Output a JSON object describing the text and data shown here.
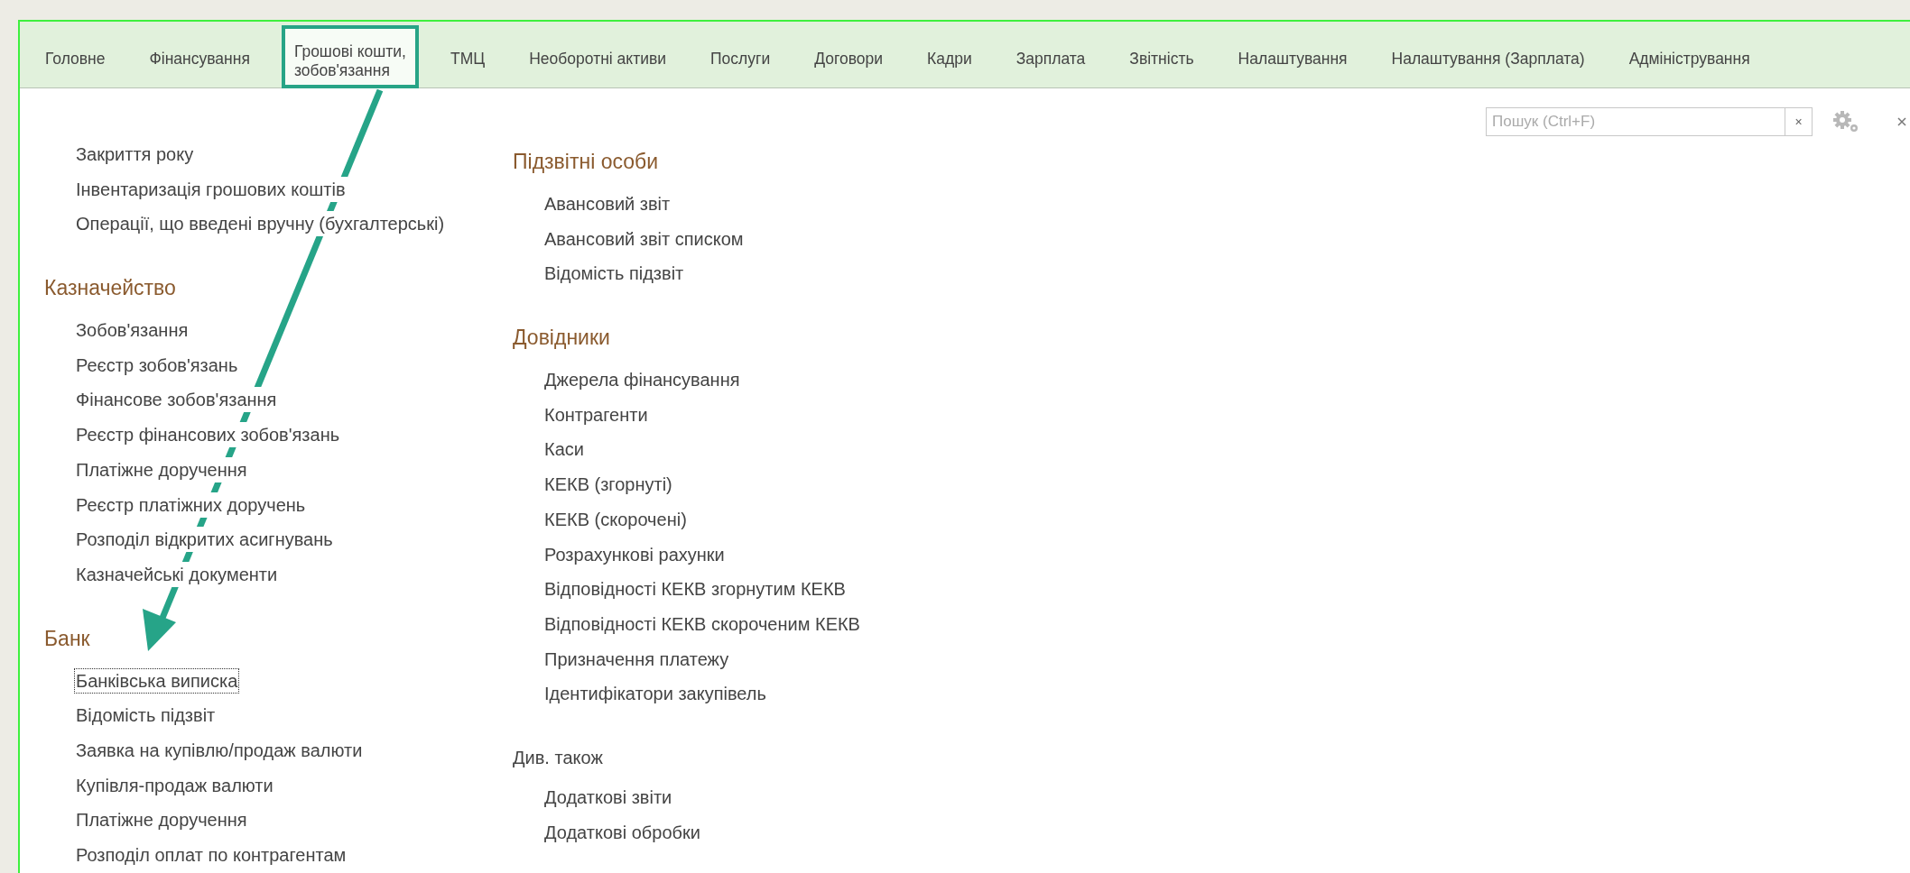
{
  "menu": [
    {
      "label": "Головне",
      "selected": false
    },
    {
      "label": "Фінансування",
      "selected": false
    },
    {
      "label": "Грошові кошти,\nзобов'язання",
      "selected": true
    },
    {
      "label": "ТМЦ",
      "selected": false
    },
    {
      "label": "Необоротні активи",
      "selected": false
    },
    {
      "label": "Послуги",
      "selected": false
    },
    {
      "label": "Договори",
      "selected": false
    },
    {
      "label": "Кадри",
      "selected": false
    },
    {
      "label": "Зарплата",
      "selected": false
    },
    {
      "label": "Звітність",
      "selected": false
    },
    {
      "label": "Налаштування",
      "selected": false
    },
    {
      "label": "Налаштування (Зарплата)",
      "selected": false
    },
    {
      "label": "Адміністрування",
      "selected": false
    }
  ],
  "search": {
    "placeholder": "Пошук (Ctrl+F)",
    "clear": "×"
  },
  "columns": [
    {
      "sections": [
        {
          "items": [
            {
              "label": "Закриття року",
              "focused": false
            },
            {
              "label": "Інвентаризація грошових коштів",
              "focused": false
            },
            {
              "label": "Операції, що введені вручну (бухгалтерські)",
              "focused": false
            }
          ]
        },
        {
          "heading": "Казначейство",
          "secondary": false,
          "items": [
            {
              "label": "Зобов'язання",
              "focused": false
            },
            {
              "label": "Реєстр зобов'язань",
              "focused": false
            },
            {
              "label": "Фінансове зобов'язання",
              "focused": false
            },
            {
              "label": "Реєстр фінансових зобов'язань",
              "focused": false
            },
            {
              "label": "Платіжне доручення",
              "focused": false
            },
            {
              "label": "Реєстр платіжних доручень",
              "focused": false
            },
            {
              "label": "Розподіл відкритих асигнувань",
              "focused": false
            },
            {
              "label": "Казначейські документи",
              "focused": false
            }
          ]
        },
        {
          "heading": "Банк",
          "secondary": false,
          "items": [
            {
              "label": "Банківська виписка",
              "focused": true
            },
            {
              "label": "Відомість підзвіт",
              "focused": false
            },
            {
              "label": "Заявка на купівлю/продаж валюти",
              "focused": false
            },
            {
              "label": "Купівля-продаж валюти",
              "focused": false
            },
            {
              "label": "Платіжне доручення",
              "focused": false
            },
            {
              "label": "Розподіл оплат по контрагентам",
              "focused": false
            }
          ]
        }
      ]
    },
    {
      "sections": [
        {
          "heading": "Підзвітні особи",
          "secondary": false,
          "items": [
            {
              "label": "Авансовий звіт",
              "focused": false
            },
            {
              "label": "Авансовий звіт списком",
              "focused": false
            },
            {
              "label": "Відомість підзвіт",
              "focused": false
            }
          ]
        },
        {
          "heading": "Довідники",
          "secondary": false,
          "items": [
            {
              "label": "Джерела фінансування",
              "focused": false
            },
            {
              "label": "Контрагенти",
              "focused": false
            },
            {
              "label": "Каси",
              "focused": false
            },
            {
              "label": "КЕКВ (згорнуті)",
              "focused": false
            },
            {
              "label": "КЕКВ (скорочені)",
              "focused": false
            },
            {
              "label": "Розрахункові рахунки",
              "focused": false
            },
            {
              "label": "Відповідності КЕКВ згорнутим КЕКВ",
              "focused": false
            },
            {
              "label": "Відповідності КЕКВ скороченим КЕКВ",
              "focused": false
            },
            {
              "label": "Призначення платежу",
              "focused": false
            },
            {
              "label": "Ідентифікатори закупівель",
              "focused": false
            }
          ]
        },
        {
          "heading": "Див. також",
          "secondary": true,
          "items": [
            {
              "label": "Додаткові звіти",
              "focused": false
            },
            {
              "label": "Додаткові обробки",
              "focused": false
            }
          ]
        }
      ]
    }
  ]
}
